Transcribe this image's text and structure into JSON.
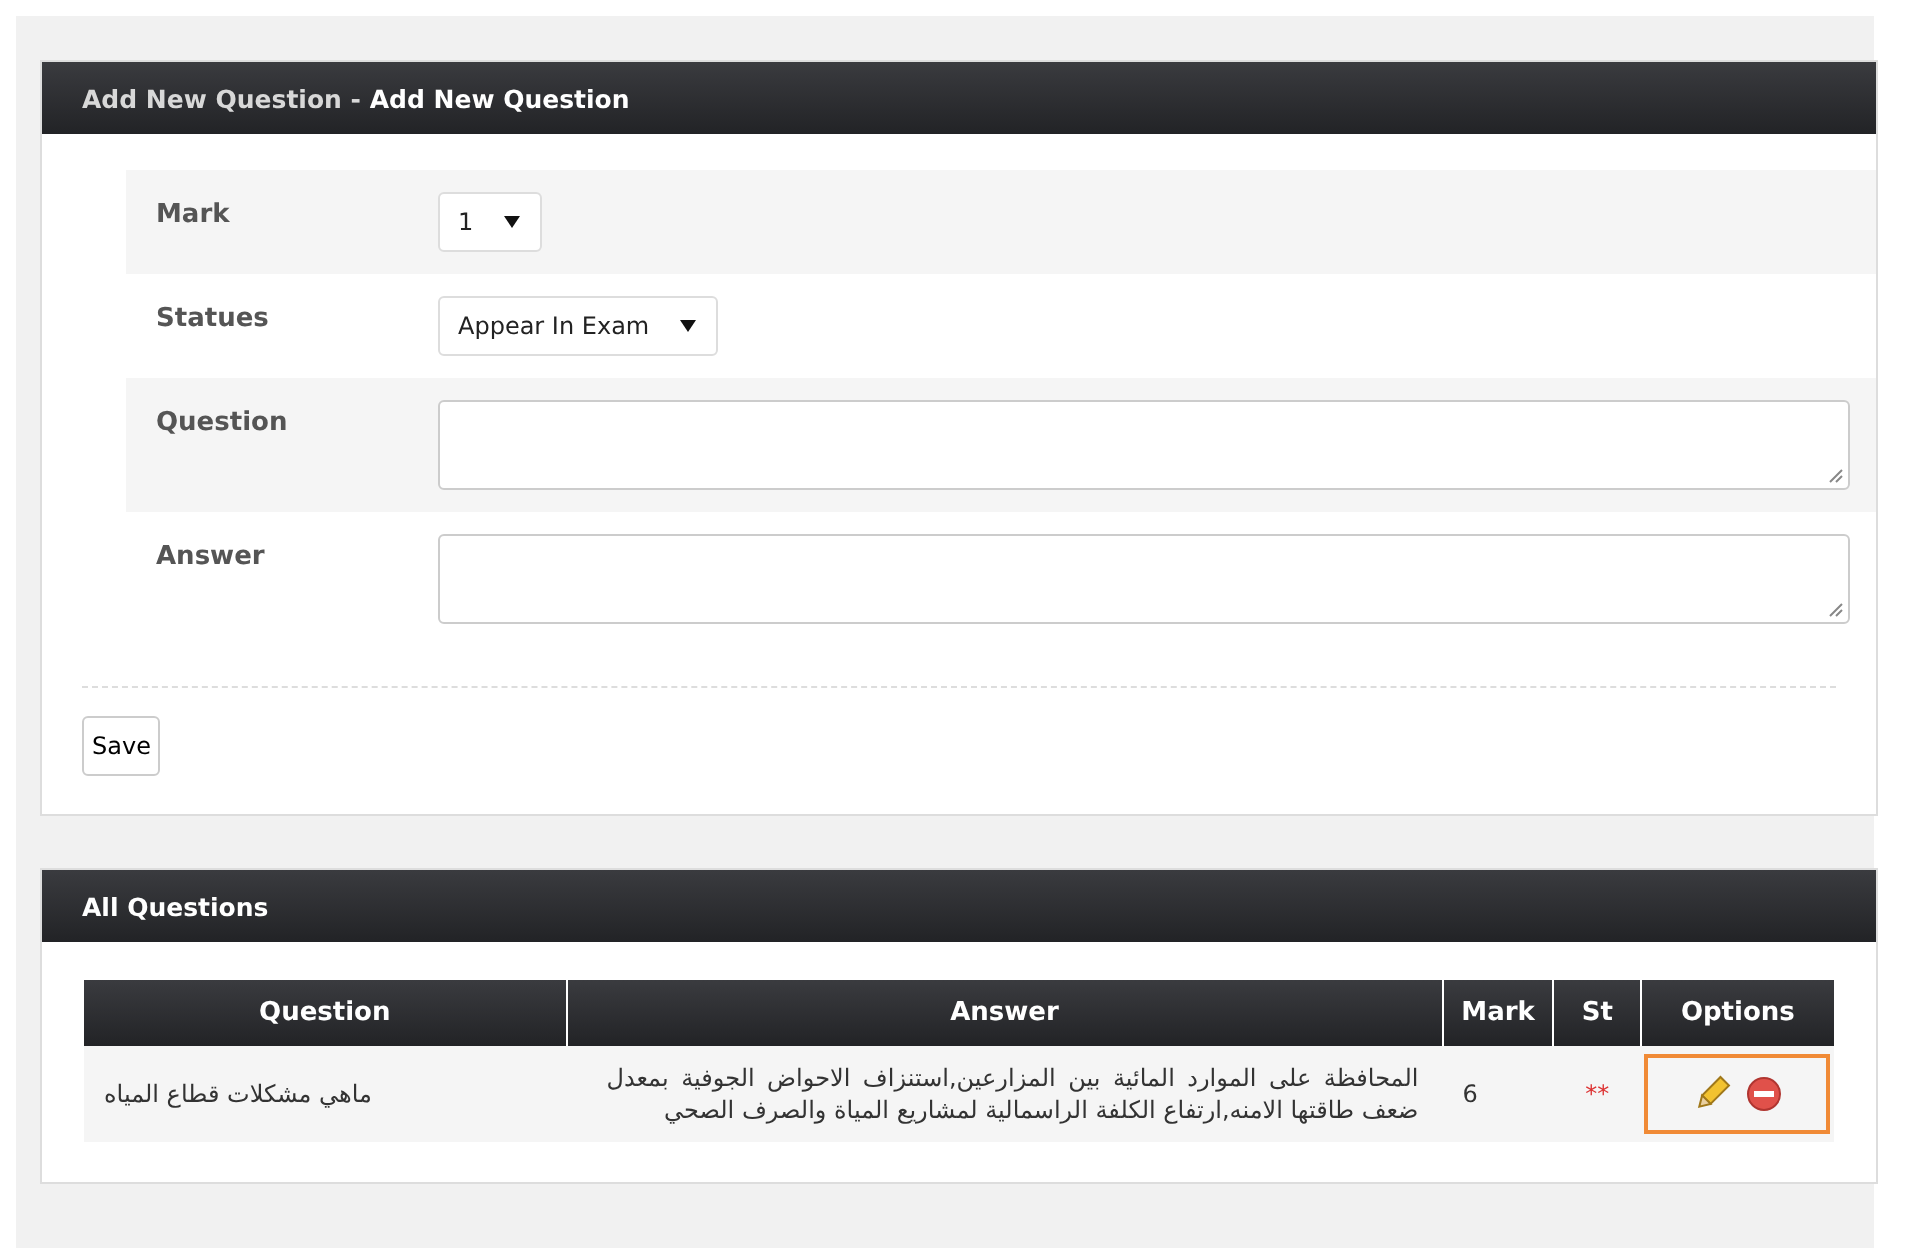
{
  "add_panel": {
    "title_prefix": "Add New Question - ",
    "title": "Add New Question",
    "fields": [
      {
        "label": "Mark",
        "kind": "select",
        "value": "1"
      },
      {
        "label": "Statues",
        "kind": "select",
        "value": "Appear In Exam"
      },
      {
        "label": "Question",
        "kind": "textarea"
      },
      {
        "label": "Answer",
        "kind": "textarea"
      }
    ],
    "save_button": "Save"
  },
  "list_panel": {
    "title": "All Questions",
    "table": {
      "columns": [
        "Question",
        "Answer",
        "Mark",
        "St",
        "Options"
      ],
      "rows": [
        {
          "question": "ماهي مشكلات قطاع المياه",
          "answer": "المحافظة على الموارد المائية بين المزارعين,استنزاف الاحواض الجوفية بمعدل ضعف طاقتها الامنه,ارتفاع الكلفة الراسمالية لمشاريع المياة والصرف الصحي",
          "mark": "6",
          "status": "**",
          "options_highlighted": true
        }
      ]
    }
  }
}
